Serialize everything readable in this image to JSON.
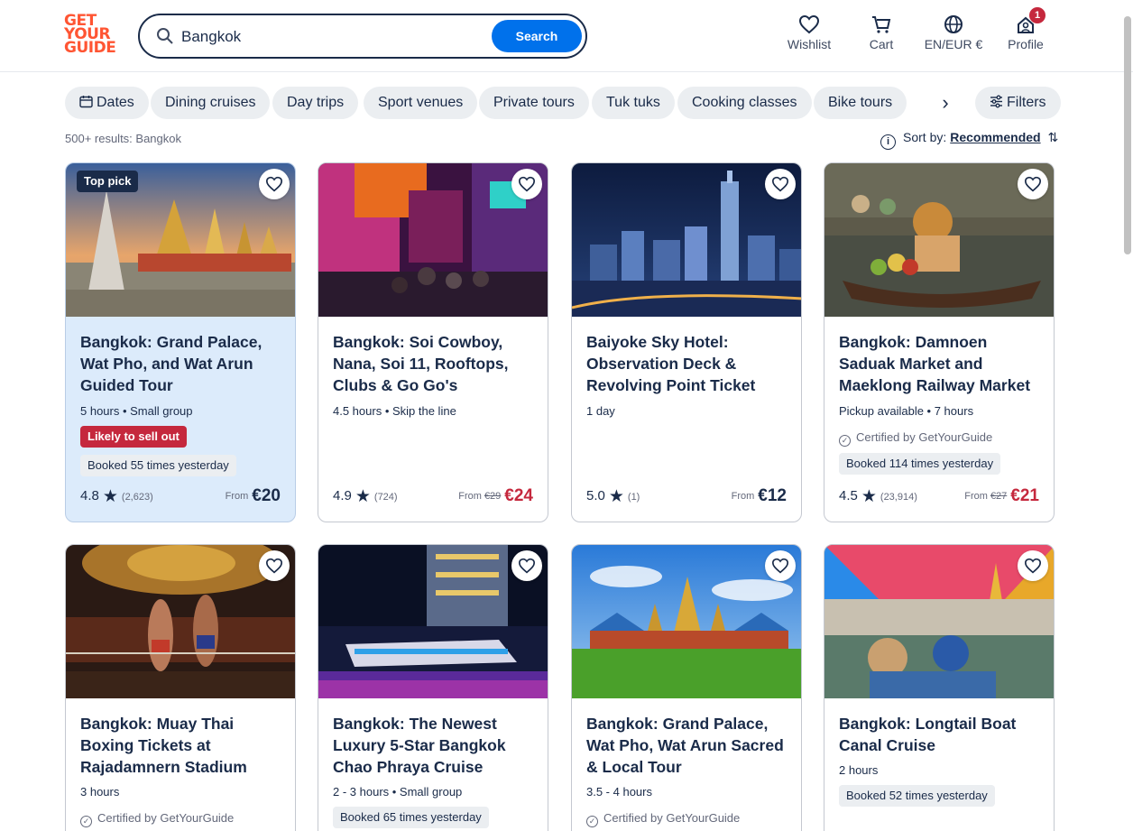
{
  "header": {
    "logo_lines": [
      "GET",
      "YOUR",
      "GUIDE"
    ],
    "search_value": "Bangkok",
    "search_button": "Search",
    "nav": [
      {
        "label": "Wishlist",
        "icon": "heart-icon"
      },
      {
        "label": "Cart",
        "icon": "cart-icon"
      },
      {
        "label": "EN/EUR €",
        "icon": "globe-icon"
      },
      {
        "label": "Profile",
        "icon": "profile-icon",
        "badge": "1"
      }
    ]
  },
  "filters": {
    "chips": [
      "Dates",
      "Dining cruises",
      "Day trips",
      "Sport venues",
      "Private tours",
      "Tuk tuks",
      "Cooking classes",
      "Bike tours"
    ],
    "filters_label": "Filters"
  },
  "results": {
    "count_text": "500+ results: Bangkok",
    "sort_label": "Sort by:",
    "sort_value": "Recommended"
  },
  "cards": [
    {
      "title": "Bangkok: Grand Palace, Wat Pho, and Wat Arun Guided Tour",
      "badge": "Top pick",
      "meta": "5 hours • Small group",
      "urgent": "Likely to sell out",
      "booked": "Booked 55 times yesterday",
      "rating": "4.8",
      "reviews": "(2,623)",
      "from": "From",
      "price": "€20",
      "highlight": true
    },
    {
      "title": "Bangkok: Soi Cowboy, Nana, Soi 11, Rooftops, Clubs & Go Go's",
      "meta": "4.5 hours • Skip the line",
      "rating": "4.9",
      "reviews": "(724)",
      "from": "From",
      "old_price": "€29",
      "price": "€24"
    },
    {
      "title": "Baiyoke Sky Hotel: Observation Deck & Revolving Point Ticket",
      "meta": "1 day",
      "rating": "5.0",
      "reviews": "(1)",
      "from": "From",
      "price": "€12"
    },
    {
      "title": "Bangkok: Damnoen Saduak Market and Maeklong Railway Market",
      "meta": "Pickup available • 7 hours",
      "certified": "Certified by GetYourGuide",
      "booked": "Booked 114 times yesterday",
      "rating": "4.5",
      "reviews": "(23,914)",
      "from": "From",
      "old_price": "€27",
      "price": "€21"
    },
    {
      "title": "Bangkok: Muay Thai Boxing Tickets at Rajadamnern Stadium",
      "meta": "3 hours",
      "certified": "Certified by GetYourGuide"
    },
    {
      "title": "Bangkok: The Newest Luxury 5-Star Bangkok Chao Phraya Cruise",
      "meta": "2 - 3 hours • Small group",
      "booked": "Booked 65 times yesterday"
    },
    {
      "title": "Bangkok: Grand Palace, Wat Pho, Wat Arun Sacred & Local Tour",
      "meta": "3.5 - 4 hours",
      "certified": "Certified by GetYourGuide"
    },
    {
      "title": "Bangkok: Longtail Boat Canal Cruise",
      "meta": "2 hours",
      "booked": "Booked 52 times yesterday"
    }
  ],
  "colors": {
    "brand": "#ff5533",
    "accent": "#0071eb",
    "urgent": "#c5283d",
    "text": "#1a2b49"
  }
}
